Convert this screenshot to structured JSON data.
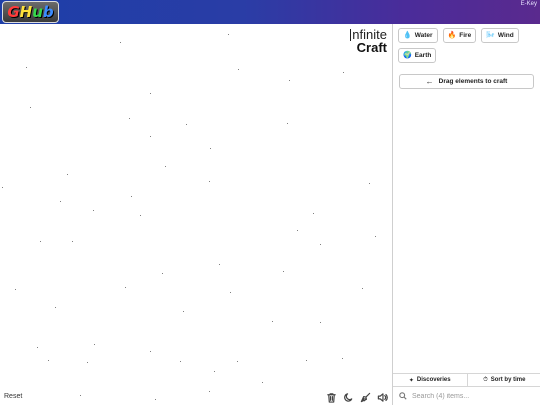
{
  "header": {
    "logo_text": "GHub",
    "right_label": "E-Key",
    "gradient_colors": [
      "#1d3ea8",
      "#5a2a8e"
    ]
  },
  "canvas": {
    "title_line1": "nfinite",
    "title_line2": "Craft",
    "reset_label": "Reset",
    "tools": [
      "trash-icon",
      "moon-icon",
      "broom-icon",
      "speaker-icon"
    ]
  },
  "sidebar": {
    "items": [
      {
        "emoji": "💧",
        "label": "Water"
      },
      {
        "emoji": "🔥",
        "label": "Fire"
      },
      {
        "emoji": "🌬️",
        "label": "Wind"
      },
      {
        "emoji": "🌍",
        "label": "Earth"
      }
    ],
    "drag_hint": "Drag elements to craft",
    "drag_hint_icon": "←",
    "tabs": [
      {
        "icon": "sparkle-icon",
        "glyph": "✦",
        "label": "Discoveries"
      },
      {
        "icon": "clock-icon",
        "glyph": "⏱",
        "label": "Sort by time"
      }
    ],
    "search_placeholder": "Search (4) items..."
  }
}
